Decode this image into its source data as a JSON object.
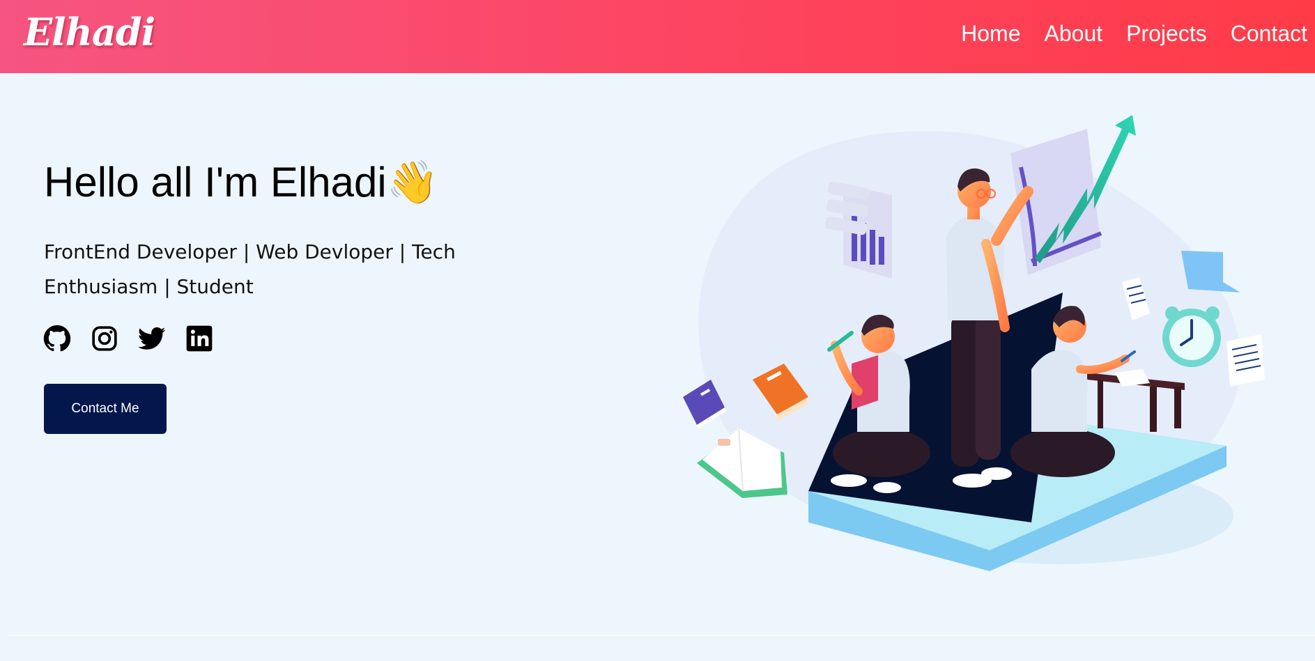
{
  "brand": {
    "logo": "Elhadi"
  },
  "nav": {
    "items": [
      {
        "label": "Home"
      },
      {
        "label": "About"
      },
      {
        "label": "Projects"
      },
      {
        "label": "Contact"
      }
    ]
  },
  "hero": {
    "title": "Hello all I'm Elhadi",
    "wave_emoji": "👋",
    "subtitle": "FrontEnd Developer | Web Devloper | Tech Enthusiasm | Student",
    "contact_button": "Contact Me"
  },
  "socials": [
    {
      "icon": "github-icon"
    },
    {
      "icon": "instagram-icon"
    },
    {
      "icon": "twitter-icon"
    },
    {
      "icon": "linkedin-icon"
    }
  ],
  "colors": {
    "nav_gradient_start": "#f65581",
    "nav_gradient_end": "#ff3b47",
    "background": "#eef6fd",
    "button": "#04174d"
  }
}
